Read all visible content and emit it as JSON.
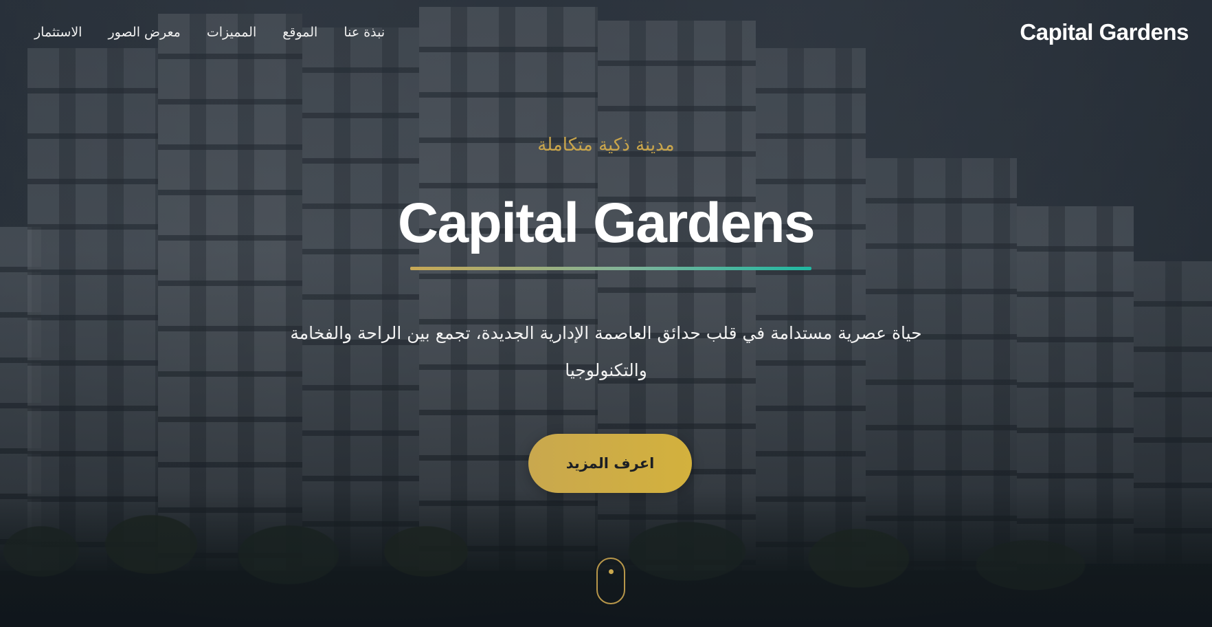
{
  "brand": {
    "name": "Capital Gardens"
  },
  "nav": {
    "items": [
      {
        "label": "نبذة عنا"
      },
      {
        "label": "الموقع"
      },
      {
        "label": "المميزات"
      },
      {
        "label": "معرض الصور"
      },
      {
        "label": "الاستثمار"
      }
    ]
  },
  "hero": {
    "tagline": "مدينة ذكية متكاملة",
    "title": "Capital Gardens",
    "description": "حياة عصرية مستدامة في قلب حدائق العاصمة الإدارية الجديدة، تجمع بين الراحة والفخامة والتكنولوجيا",
    "cta_label": "اعرف المزيد"
  },
  "colors": {
    "accent_gold": "#c9a84e",
    "accent_teal": "#1fb8a2",
    "text_light": "#ffffff"
  }
}
